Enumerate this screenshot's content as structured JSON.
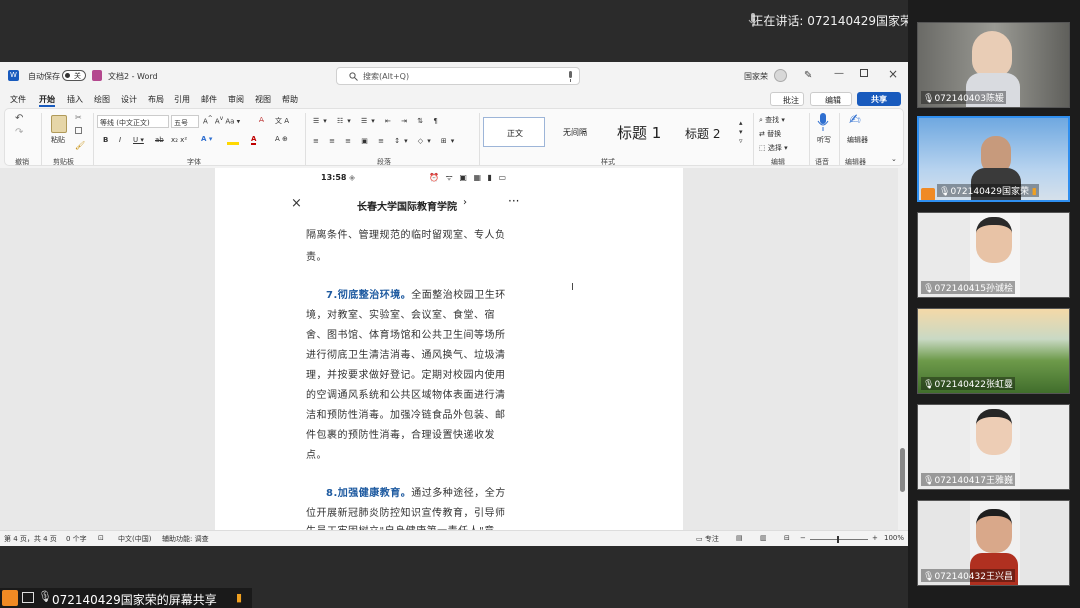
{
  "meeting": {
    "speaking_label": "正在讲话: 072140429国家荣",
    "share_label": "072140429国家荣的屏幕共享"
  },
  "word": {
    "autosave_label": "自动保存",
    "autosave_state": "关",
    "doc_title": "文档2 - Word",
    "search_placeholder": "搜索(Alt+Q)",
    "user_name": "国家荣",
    "menu": [
      "文件",
      "开始",
      "插入",
      "绘图",
      "设计",
      "布局",
      "引用",
      "邮件",
      "审阅",
      "视图",
      "帮助"
    ],
    "comment_btn": "批注",
    "edit_btn": "编辑",
    "share_btn": "共享",
    "ribbon": {
      "undo_label": "撤销",
      "paste_label": "粘贴",
      "clipboard_label": "剪贴板",
      "font_name": "等线 (中文正文)",
      "font_size": "五号",
      "font_group": "字体",
      "paragraph_group": "段落",
      "styles": [
        "正文",
        "无间隔",
        "标题 1",
        "标题 2"
      ],
      "styles_group": "样式",
      "find": "查找",
      "replace": "替换",
      "select": "选择",
      "edit_group": "编辑",
      "dictate": "听写",
      "voice_group": "语音",
      "editor": "编辑器",
      "editor_group": "编辑器"
    },
    "status": {
      "page": "第 4 页，共 4 页",
      "words": "0 个字",
      "lang": "中文(中国)",
      "accessibility": "辅助功能: 调查",
      "focus": "专注",
      "zoom": "100%"
    }
  },
  "phone": {
    "time": "13:58",
    "header_title": "长春大学国际教育学院",
    "lines": [
      "隔离条件、管理规范的临时留观室、专人负",
      "责。"
    ],
    "para7_head": "7.彻底整治环境。",
    "para7_first": "全面整治校园卫生环",
    "para7_lines": [
      "境，对教室、实验室、会议室、食堂、宿",
      "舍、图书馆、体育场馆和公共卫生间等场所",
      "进行彻底卫生清洁消毒、通风换气、垃圾清",
      "理，并按要求做好登记。定期对校园内使用",
      "的空调通风系统和公共区域物体表面进行清",
      "洁和预防性消毒。加强冷链食品外包装、邮",
      "件包裹的预防性消毒，合理设置快递收发",
      "点。"
    ],
    "para8_head": "8.加强健康教育。",
    "para8_first": "通过多种途径，全方",
    "para8_lines": [
      "位开展新冠肺炎防控知识宣传教育，引导师",
      "生员工牢固树立\"自身健康第一责任人\"意"
    ]
  },
  "participants": [
    {
      "name": "072140403陈媛",
      "active": false
    },
    {
      "name": "072140429国家荣",
      "active": true
    },
    {
      "name": "072140415孙诚桧",
      "active": false
    },
    {
      "name": "072140422张虹曼",
      "active": false
    },
    {
      "name": "072140417王雅巍",
      "active": false
    },
    {
      "name": "072140432王兴昌",
      "active": false
    }
  ],
  "colors": {
    "accent": "#2f8ff0",
    "word_blue": "#185abd",
    "heading_blue": "#1e5aa0"
  }
}
